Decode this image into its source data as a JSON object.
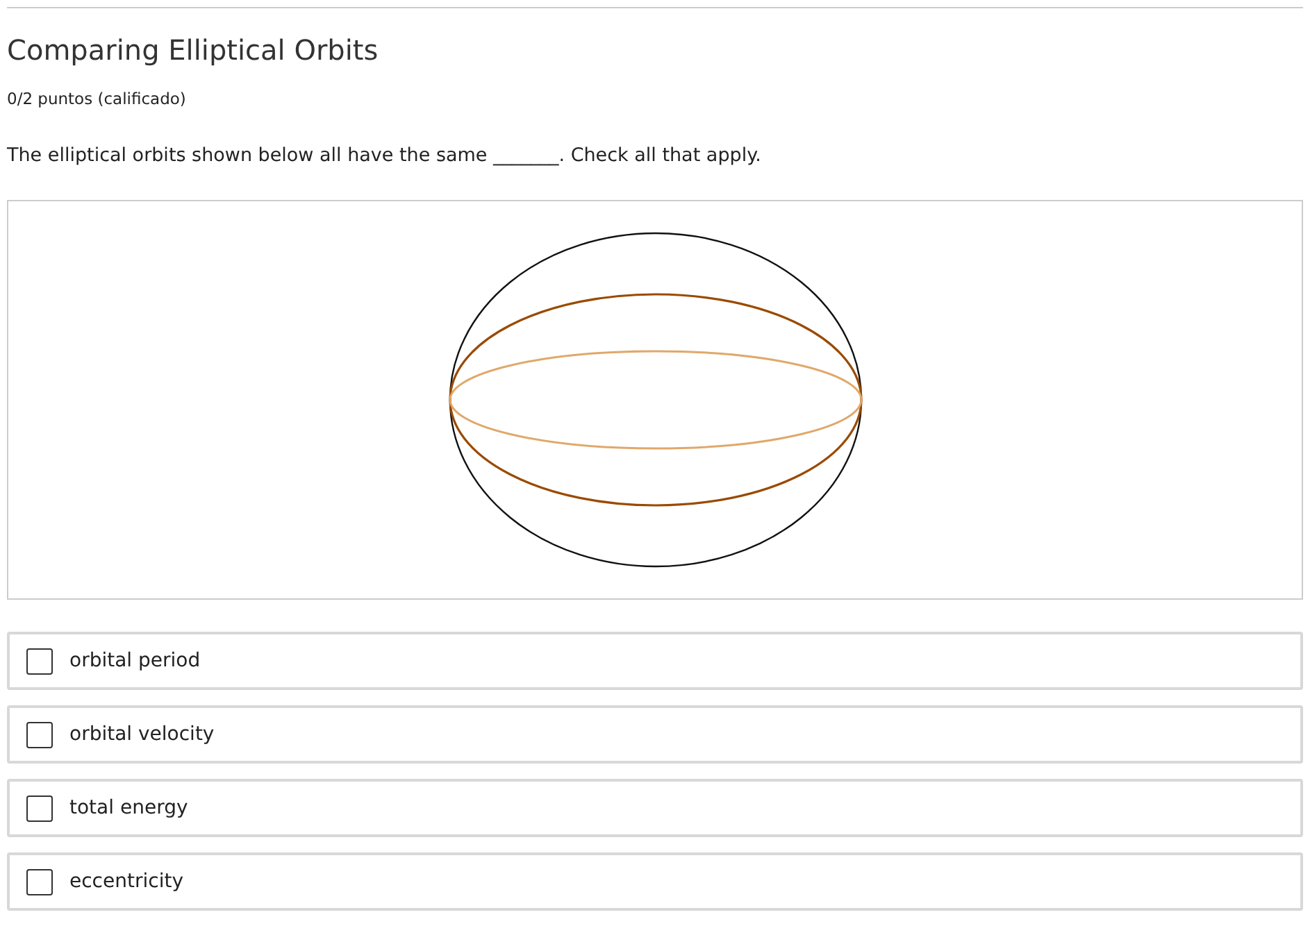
{
  "title": "Comparing Elliptical Orbits",
  "score": "0/2 puntos (calificado)",
  "question": "The elliptical orbits shown below all have the same _______. Check all that apply.",
  "options": [
    {
      "label": "orbital period",
      "checked": false
    },
    {
      "label": "orbital velocity",
      "checked": false
    },
    {
      "label": "total energy",
      "checked": false
    },
    {
      "label": "eccentricity",
      "checked": false
    }
  ]
}
